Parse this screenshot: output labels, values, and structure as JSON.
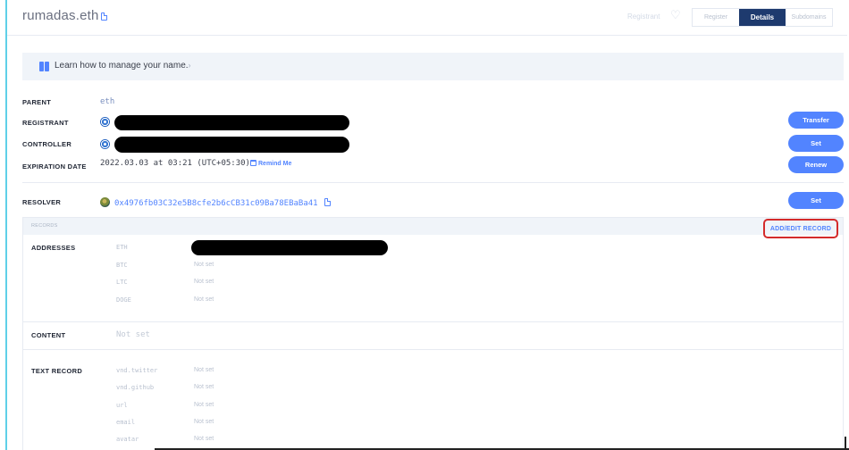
{
  "header": {
    "name": "rumadas.eth",
    "registrant_link": "Registrant",
    "tabs": [
      {
        "label": "Register",
        "active": false
      },
      {
        "label": "Details",
        "active": true
      },
      {
        "label": "Subdomains",
        "active": false
      }
    ]
  },
  "banner": {
    "text": "Learn how to manage your name.",
    "arrow": "›"
  },
  "details": {
    "parent_label": "PARENT",
    "parent_value": "eth",
    "registrant_label": "REGISTRANT",
    "controller_label": "CONTROLLER",
    "expiration_label": "EXPIRATION DATE",
    "expiration_value": "2022.03.03 at 03:21 (UTC+05:30)",
    "remind_me": "Remind Me",
    "transfer_button": "Transfer",
    "set_controller_button": "Set",
    "renew_button": "Renew"
  },
  "resolver": {
    "label": "RESOLVER",
    "address": "0x4976fb03C32e5B8cfe2b6cCB31c09Ba78EBaBa41",
    "set_button": "Set"
  },
  "records": {
    "title": "RECORDS",
    "add_edit_button": "ADD/EDIT RECORD",
    "addresses_label": "ADDRESSES",
    "addresses": [
      {
        "key": "ETH",
        "value": ""
      },
      {
        "key": "BTC",
        "value": "Not set"
      },
      {
        "key": "LTC",
        "value": "Not set"
      },
      {
        "key": "DOGE",
        "value": "Not set"
      }
    ],
    "content_label": "CONTENT",
    "content_value": "Not set",
    "text_record_label": "TEXT RECORD",
    "text_records": [
      {
        "key": "vnd.twitter",
        "value": "Not set"
      },
      {
        "key": "vnd.github",
        "value": "Not set"
      },
      {
        "key": "url",
        "value": "Not set"
      },
      {
        "key": "email",
        "value": "Not set"
      },
      {
        "key": "avatar",
        "value": "Not set"
      }
    ]
  },
  "colors": {
    "accent": "#5284ff",
    "active_tab": "#1e3a6e",
    "highlight_box": "#d42b2b"
  },
  "icons": [
    "copy-icon",
    "heart-icon",
    "book-icon",
    "calendar-icon",
    "avatar-icon"
  ]
}
